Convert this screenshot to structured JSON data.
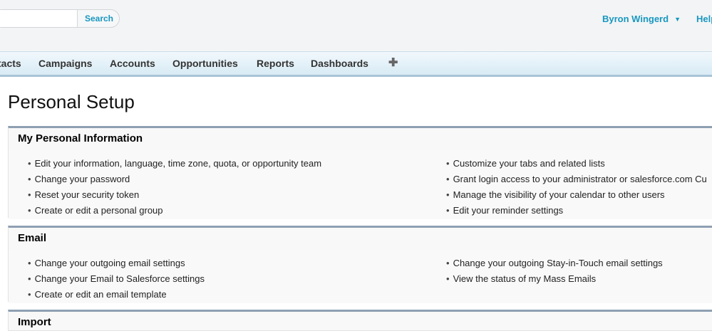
{
  "header": {
    "search_placeholder": "",
    "search_label": "Search",
    "user_name": "Byron Wingerd",
    "help_label": "Help"
  },
  "tabs": [
    "tacts",
    "Campaigns",
    "Accounts",
    "Opportunities",
    "Reports",
    "Dashboards"
  ],
  "tab_plus": "✚",
  "page_title": "Personal Setup",
  "sections": {
    "personal": {
      "title": "My Personal Information",
      "left": [
        "Edit your information, language, time zone, quota, or opportunity team",
        "Change your password",
        "Reset your security token",
        "Create or edit a personal group"
      ],
      "right": [
        "Customize your tabs and related lists",
        "Grant login access to your administrator or salesforce.com Cu",
        "Manage the visibility of your calendar to other users",
        "Edit your reminder settings"
      ]
    },
    "email": {
      "title": "Email",
      "left": [
        "Change your outgoing email settings",
        "Change your Email to Salesforce settings",
        "Create or edit an email template"
      ],
      "right": [
        "Change your outgoing Stay-in-Touch email settings",
        "View the status of my Mass Emails"
      ]
    },
    "import": {
      "title": "Import"
    }
  }
}
